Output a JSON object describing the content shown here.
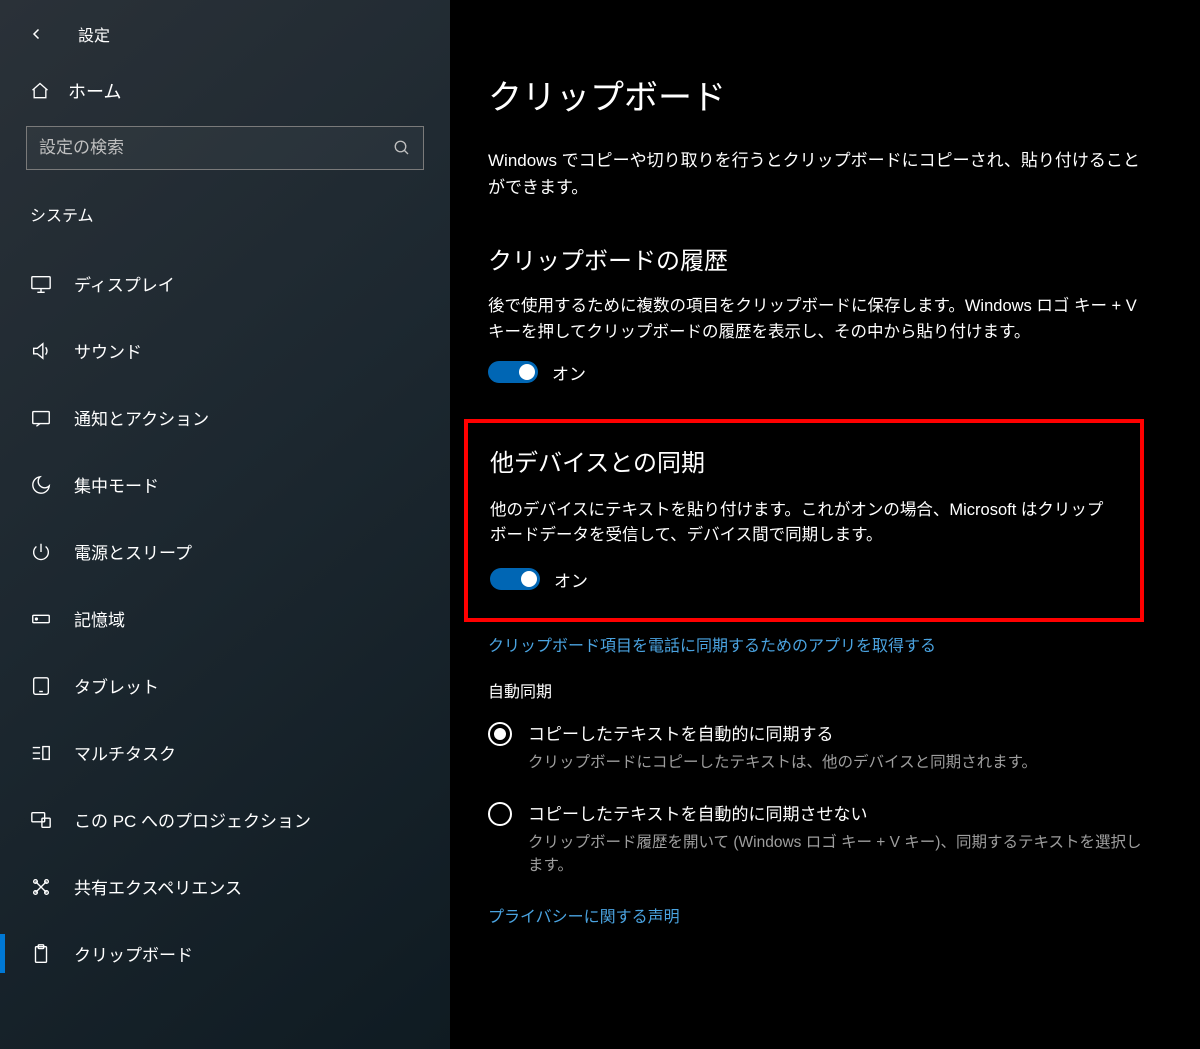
{
  "header": {
    "title": "設定"
  },
  "sidebar": {
    "home_label": "ホーム",
    "search_placeholder": "設定の検索",
    "category": "システム",
    "items": [
      {
        "label": "ディスプレイ",
        "icon": "display-icon"
      },
      {
        "label": "サウンド",
        "icon": "sound-icon"
      },
      {
        "label": "通知とアクション",
        "icon": "notification-icon"
      },
      {
        "label": "集中モード",
        "icon": "focus-icon"
      },
      {
        "label": "電源とスリープ",
        "icon": "power-icon"
      },
      {
        "label": "記憶域",
        "icon": "storage-icon"
      },
      {
        "label": "タブレット",
        "icon": "tablet-icon"
      },
      {
        "label": "マルチタスク",
        "icon": "multitask-icon"
      },
      {
        "label": "この PC へのプロジェクション",
        "icon": "projection-icon"
      },
      {
        "label": "共有エクスペリエンス",
        "icon": "shared-experience-icon"
      },
      {
        "label": "クリップボード",
        "icon": "clipboard-icon"
      }
    ],
    "selected_index": 10
  },
  "main": {
    "page_title": "クリップボード",
    "intro": "Windows でコピーや切り取りを行うとクリップボードにコピーされ、貼り付けることができます。",
    "history": {
      "title": "クリップボードの履歴",
      "desc": "後で使用するために複数の項目をクリップボードに保存します。Windows ロゴ キー + V キーを押してクリップボードの履歴を表示し、その中から貼り付けます。",
      "toggle_label": "オン",
      "toggle_on": true
    },
    "sync": {
      "title": "他デバイスとの同期",
      "desc": "他のデバイスにテキストを貼り付けます。これがオンの場合、Microsoft はクリップボードデータを受信して、デバイス間で同期します。",
      "toggle_label": "オン",
      "toggle_on": true,
      "link_text": "クリップボード項目を電話に同期するためのアプリを取得する",
      "auto_sync_heading": "自動同期",
      "radio": [
        {
          "title": "コピーしたテキストを自動的に同期する",
          "desc": "クリップボードにコピーしたテキストは、他のデバイスと同期されます。",
          "checked": true
        },
        {
          "title": "コピーしたテキストを自動的に同期させない",
          "desc": "クリップボード履歴を開いて (Windows ロゴ キー + V キー)、同期するテキストを選択します。",
          "checked": false
        }
      ]
    },
    "privacy_link": "プライバシーに関する声明"
  }
}
